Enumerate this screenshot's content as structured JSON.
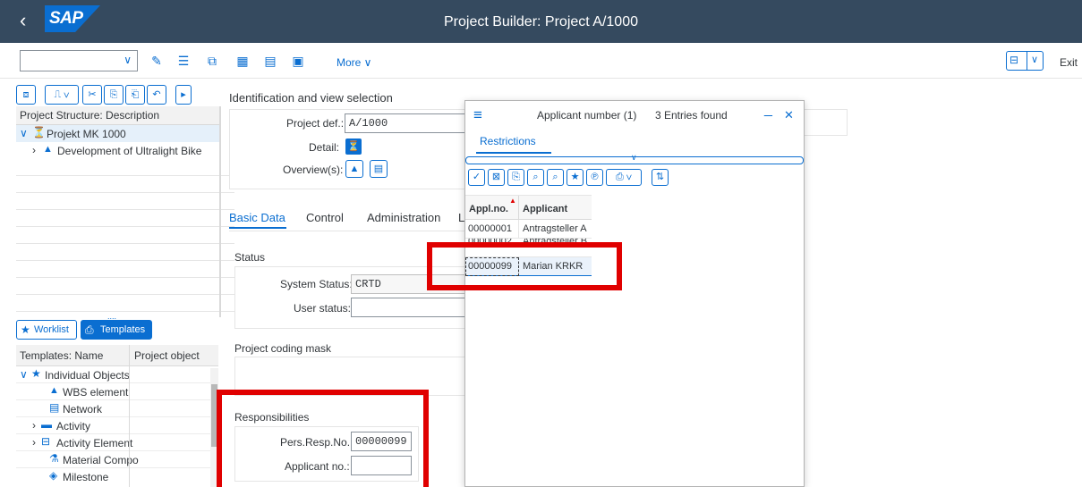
{
  "shell": {
    "back_glyph": "‹",
    "logo": "SAP",
    "title": "Project Builder: Project A/1000"
  },
  "toolbar": {
    "combo_value": "",
    "more_label": "More",
    "exit_label": "Exit"
  },
  "left": {
    "structure_header": "Project Structure: Description",
    "tree": [
      {
        "label": "Projekt MK 1000",
        "level": 0,
        "expanded": true
      },
      {
        "label": "Development of Ultralight Bike",
        "level": 1,
        "expanded": false
      }
    ],
    "splitter_glyph": "....",
    "worklist_label": "Worklist",
    "templates_label": "Templates",
    "templates_col1": "Templates: Name",
    "templates_col2": "Project object",
    "templates": [
      {
        "label": "Individual Objects",
        "indent": 0
      },
      {
        "label": "WBS element",
        "indent": 1
      },
      {
        "label": "Network",
        "indent": 1
      },
      {
        "label": "Activity",
        "indent": 1
      },
      {
        "label": "Activity Element",
        "indent": 1
      },
      {
        "label": "Material Compo",
        "indent": 1
      },
      {
        "label": "Milestone",
        "indent": 1
      }
    ]
  },
  "main": {
    "ident_title": "Identification and view selection",
    "project_def_label": "Project def.:",
    "project_def_value": "A/1000",
    "detail_label": "Detail:",
    "overview_label": "Overview(s):",
    "tabs": [
      "Basic Data",
      "Control",
      "Administration",
      "L"
    ],
    "status_title": "Status",
    "system_status_label": "System Status:",
    "system_status_value": "CRTD",
    "user_status_label": "User status:",
    "user_status_value": "",
    "coding_mask_title": "Project coding mask",
    "resp_title": "Responsibilities",
    "pers_resp_label": "Pers.Resp.No.:",
    "pers_resp_value": "00000099",
    "applicant_label": "Applicant no.:",
    "applicant_value": ""
  },
  "dialog": {
    "menu_glyph": "≡",
    "title": "Applicant number (1)",
    "entries": "3 Entries found",
    "minimize_glyph": "_",
    "close_glyph": "✕",
    "restrictions_tab": "Restrictions",
    "col_applno": "Appl.no.",
    "col_applicant": "Applicant",
    "rows": [
      {
        "no": "00000001",
        "name": "Antragsteller A"
      },
      {
        "no": "00000002",
        "name": "Antragsteller B"
      },
      {
        "no": "00000099",
        "name": "Marian KRKR"
      }
    ]
  },
  "colors": {
    "shell": "#354a5f",
    "accent": "#0a6ed1",
    "highlight": "#e00000"
  }
}
